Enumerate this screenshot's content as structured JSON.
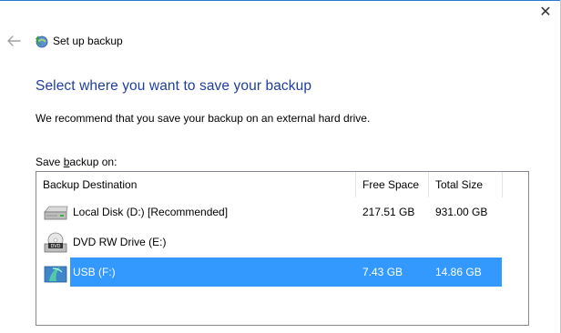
{
  "window": {
    "title": "Set up backup",
    "close_glyph": "✕"
  },
  "page": {
    "heading": "Select where you want to save your backup",
    "recommendation": "We recommend that you save your backup on an external hard drive.",
    "save_label_before": "Save ",
    "save_label_accel": "b",
    "save_label_after": "ackup on:"
  },
  "table": {
    "columns": [
      "Backup Destination",
      "Free Space",
      "Total Size"
    ],
    "rows": [
      {
        "icon": "hard-disk-icon",
        "name": "Local Disk (D:) [Recommended]",
        "free": "217.51 GB",
        "total": "931.00 GB",
        "selected": false
      },
      {
        "icon": "dvd-drive-icon",
        "name": "DVD RW Drive (E:)",
        "free": "",
        "total": "",
        "selected": false
      },
      {
        "icon": "usb-drive-icon",
        "name": "USB (F:)",
        "free": "7.43 GB",
        "total": "14.86 GB",
        "selected": true
      }
    ]
  },
  "colors": {
    "heading": "#1e3e9e",
    "selection": "#3399ff",
    "window_border": "#2b78d4"
  }
}
